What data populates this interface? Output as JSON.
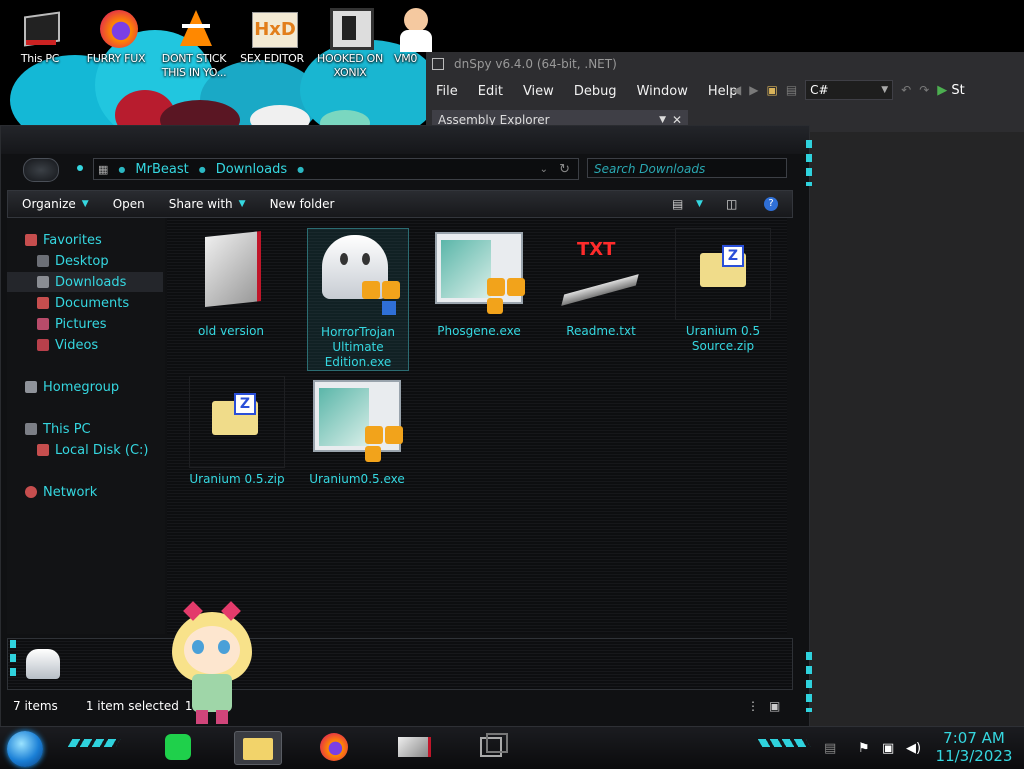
{
  "desktop": {
    "icons": [
      {
        "label": "This PC",
        "icon": "computer-icon"
      },
      {
        "label": "FURRY FUX",
        "icon": "firefox-icon"
      },
      {
        "label": "DONT STICK THIS IN YO...",
        "icon": "vlc-icon"
      },
      {
        "label": "SEX EDITOR",
        "icon": "hxd-icon"
      },
      {
        "label": "HOOKED ON XONIX",
        "icon": "game-icon"
      },
      {
        "label": "VM0",
        "icon": "doctor-icon"
      }
    ]
  },
  "dnspy": {
    "title": "dnSpy v6.4.0 (64-bit, .NET)",
    "menu": [
      "File",
      "Edit",
      "View",
      "Debug",
      "Window",
      "Help"
    ],
    "language": "C#",
    "start_label": "St",
    "assembly_explorer": "Assembly Explorer"
  },
  "explorer": {
    "breadcrumb": [
      "MrBeast",
      "Downloads"
    ],
    "search_placeholder": "Search Downloads",
    "commands": {
      "organize": "Organize",
      "open": "Open",
      "share": "Share with",
      "new_folder": "New folder"
    },
    "nav": {
      "favorites": "Favorites",
      "desktop": "Desktop",
      "downloads": "Downloads",
      "documents": "Documents",
      "pictures": "Pictures",
      "videos": "Videos",
      "homegroup": "Homegroup",
      "this_pc": "This PC",
      "local_disk": "Local Disk (C:)",
      "network": "Network"
    },
    "files": [
      {
        "name": "old version",
        "icon": "shortcut-icon"
      },
      {
        "name": "HorrorTrojan Ultimate Edition.exe",
        "icon": "ghost-icon",
        "selected": true
      },
      {
        "name": "Phosgene.exe",
        "icon": "exe-icon"
      },
      {
        "name": "Readme.txt",
        "icon": "txt-icon"
      },
      {
        "name": "Uranium 0.5 Source.zip",
        "icon": "zip-icon"
      },
      {
        "name": "Uranium 0.5.zip",
        "icon": "zip-icon"
      },
      {
        "name": "Uranium0.5.exe",
        "icon": "exe-icon"
      }
    ],
    "status": {
      "count": "7 items",
      "selected": "1 item selected",
      "size": "15"
    }
  },
  "taskbar": {
    "time": "7:07 AM",
    "date": "11/3/2023"
  },
  "colors": {
    "accent": "#35d7e0",
    "background": "#101113"
  }
}
